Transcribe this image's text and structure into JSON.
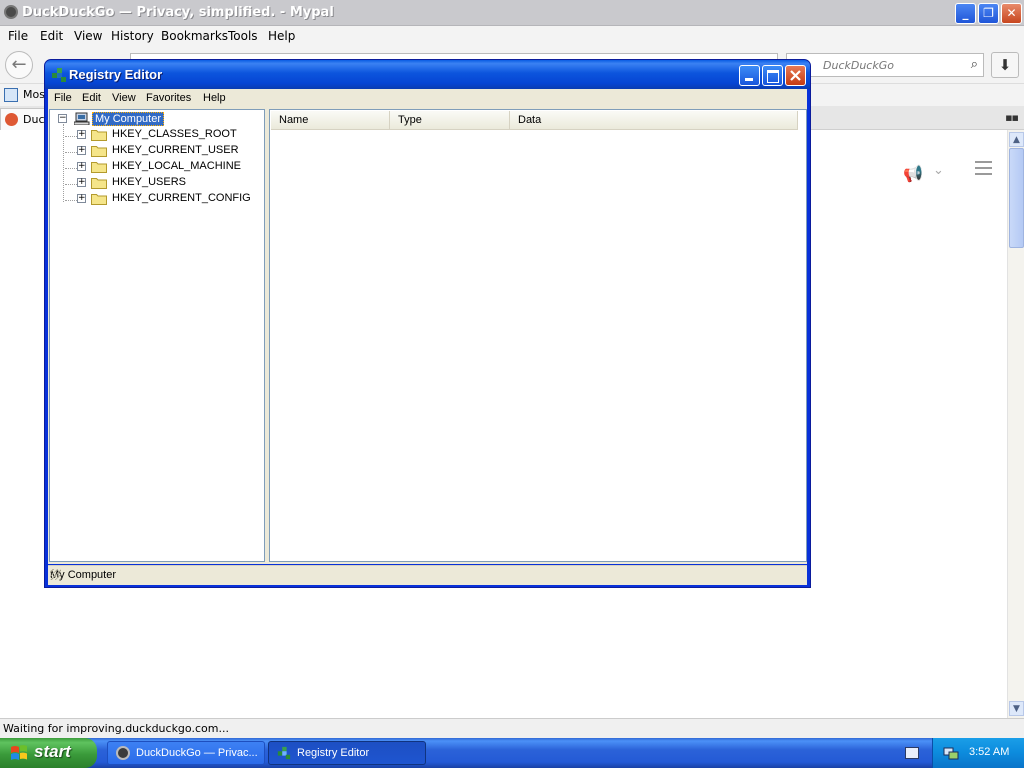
{
  "browser": {
    "title": "DuckDuckGo — Privacy, simplified. - Mypal",
    "menu": [
      "File",
      "Edit",
      "View",
      "History",
      "Bookmarks",
      "Tools",
      "Help"
    ],
    "search_placeholder": "DuckDuckGo",
    "bookmarks_label": "Most",
    "tab_label": "Duck",
    "status_text": "Waiting for improving.duckduckgo.com..."
  },
  "regedit": {
    "title": "Registry Editor",
    "menu": [
      "File",
      "Edit",
      "View",
      "Favorites",
      "Help"
    ],
    "tree": {
      "root": "My Computer",
      "hives": [
        "HKEY_CLASSES_ROOT",
        "HKEY_CURRENT_USER",
        "HKEY_LOCAL_MACHINE",
        "HKEY_USERS",
        "HKEY_CURRENT_CONFIG"
      ]
    },
    "columns": [
      "Name",
      "Type",
      "Data"
    ],
    "status": "My Computer"
  },
  "taskbar": {
    "start_label": "start",
    "tasks": [
      {
        "label": "DuckDuckGo — Privac...",
        "icon": "duckduckgo-icon"
      },
      {
        "label": "Registry Editor",
        "icon": "registry-icon"
      }
    ],
    "clock": "3:52 AM"
  },
  "colors": {
    "xp_title_blue": "#0a5de3",
    "selection": "#316ac5",
    "start_green": "#3c9c3c",
    "tray_blue": "#0c8bdd"
  }
}
